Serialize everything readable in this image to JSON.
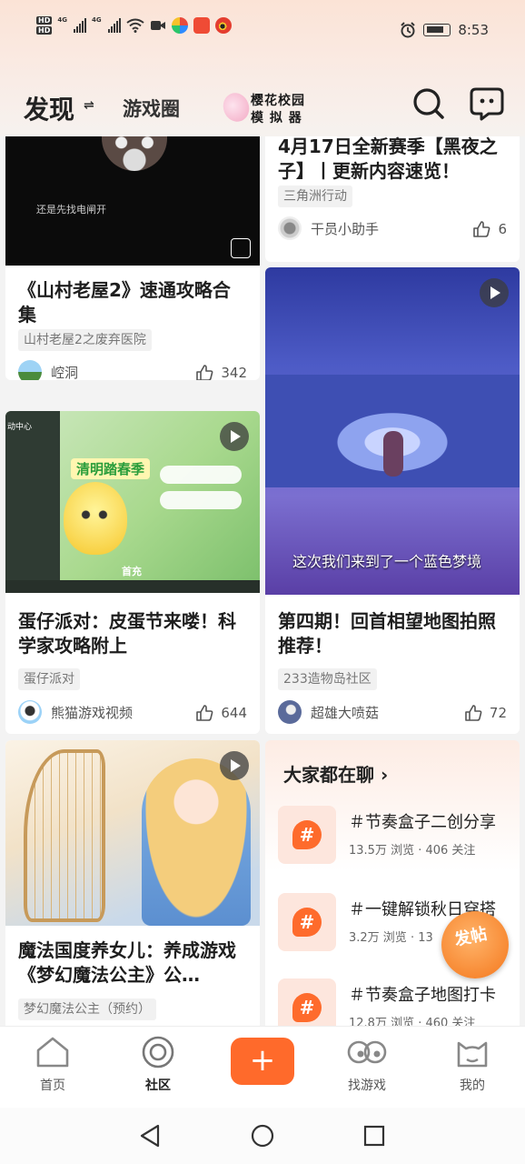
{
  "status_bar": {
    "hd1": "HD",
    "hd2": "HD",
    "net1": "4G",
    "net2": "4G",
    "time": "8:53"
  },
  "header": {
    "tab_discover": "发现",
    "switch_symbol": "⇌",
    "tab_games": "游戏圈",
    "promo_line1": "樱花校园",
    "promo_line2": "模 拟 器"
  },
  "feed": {
    "left": [
      {
        "thumb_caption": "还是先找电闸开",
        "title": "《山村老屋2》速通攻略合集",
        "tag": "山村老屋2之废弃医院",
        "author": "崆洞",
        "likes": "342"
      },
      {
        "thumb_badge": "清明踏春季",
        "thumb_sub": "首充",
        "thumb_corner": "动中心",
        "title": "蛋仔派对：皮蛋节来喽！科学家攻略附上",
        "tag": "蛋仔派对",
        "author": "熊猫游戏视频",
        "likes": "644"
      },
      {
        "title": "魔法国度养女儿：养成游戏《梦幻魔法公主》公…",
        "tag": "梦幻魔法公主（预约）"
      }
    ],
    "right": [
      {
        "title": "4月17日全新赛季【黑夜之子】丨更新内容速览！",
        "tag": "三角洲行动",
        "author": "干员小助手",
        "likes": "6"
      },
      {
        "video_subtitle": "这次我们来到了一个蓝色梦境",
        "title": "第四期！回首相望地图拍照推荐！",
        "tag": "233造物岛社区",
        "author": "超雄大喷菇",
        "likes": "72"
      }
    ],
    "hot": {
      "title": "大家都在聊 ›",
      "topics": [
        {
          "name": "＃节奏盒子二创分享",
          "stats": "13.5万 浏览 · 406 关注"
        },
        {
          "name": "＃一键解锁秋日穿搭",
          "stats": "3.2万 浏览 · 13"
        },
        {
          "name": "＃节奏盒子地图打卡",
          "stats": "12.8万 浏览 · 460 关注"
        }
      ]
    }
  },
  "fab": {
    "label": "发帖"
  },
  "bottom_nav": {
    "home": "首页",
    "community": "社区",
    "plus": "+",
    "find_games": "找游戏",
    "mine": "我的"
  },
  "colors": {
    "accent": "#ff6a2b",
    "topic_bg": "#fde6dd"
  }
}
